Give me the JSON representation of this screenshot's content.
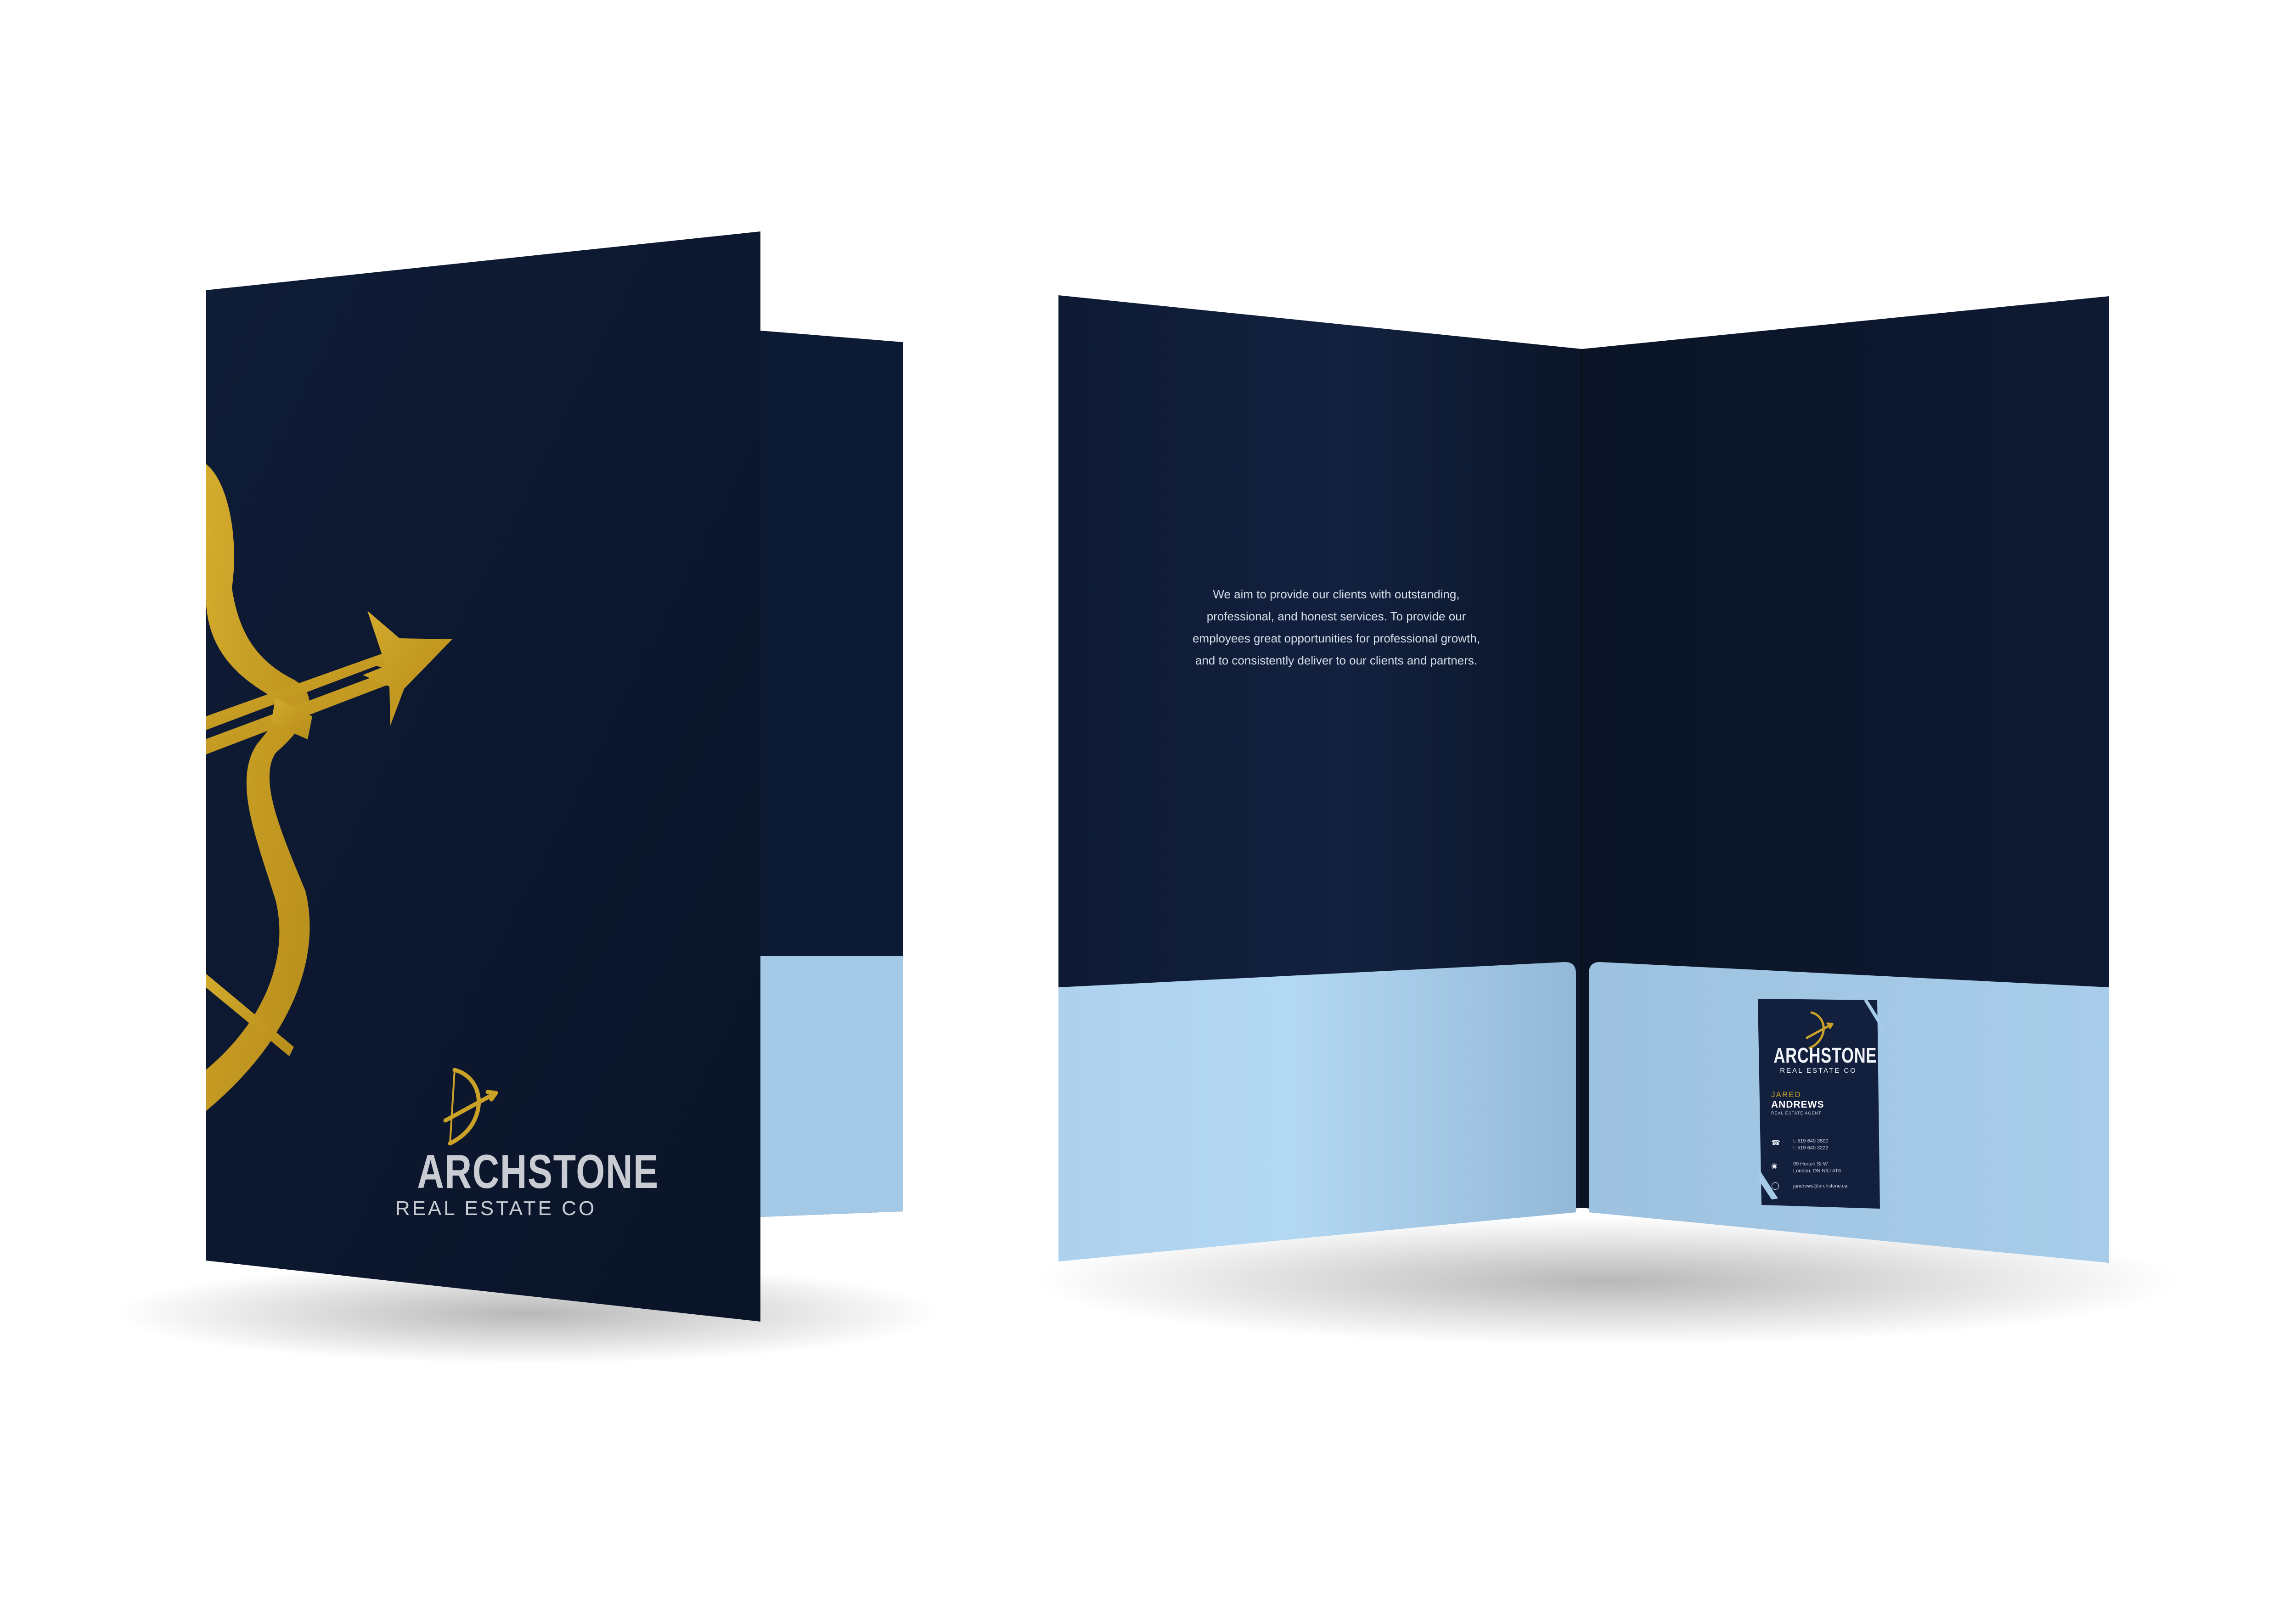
{
  "colors": {
    "background": "#ffffff",
    "folder_navy": "#0d1830",
    "pocket_blue": "#a6cbe8",
    "gold": "#c9a227",
    "logo_text": "#c9ccd2"
  },
  "cover": {
    "brand_name": "ARCHSTONE",
    "brand_sub": "REAL ESTATE CO",
    "logo_icon": "bow-and-arrow-icon"
  },
  "inside": {
    "mission_lines": [
      "We aim to provide our clients with outstanding,",
      "professional, and honest services. To provide our",
      "employees great opportunities for professional growth,",
      "and to consistently deliver to our clients and partners."
    ]
  },
  "business_card": {
    "brand_name": "ARCHSTONE",
    "brand_sub": "REAL ESTATE CO",
    "first_name": "JARED",
    "last_name": "ANDREWS",
    "role": "REAL ESTATE AGENT",
    "phone_1": "t: 519 640 3500",
    "phone_2": "f: 519 640 3222",
    "address_1": "99 Horton St W",
    "address_2": "London, ON N6J 4T6",
    "email": "jandrews@archstone.ca",
    "icons": [
      "phone-icon",
      "location-pin-icon",
      "globe-icon"
    ]
  }
}
